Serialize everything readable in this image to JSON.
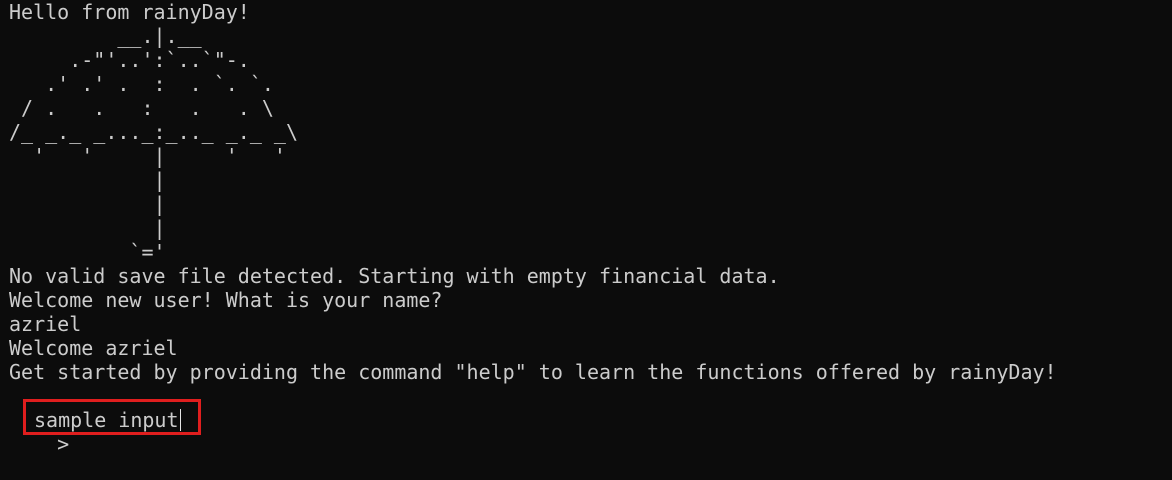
{
  "terminal": {
    "lines": [
      "Hello from rainyDay!",
      "         __.|.__",
      "     .-\"'..':`..`\"-.",
      "   .' .' .  :  . `. `.",
      " / .   .   :   .   . \\",
      "/_ _._ _..._:_.._ _._ _\\",
      "  '   '     |     '   '",
      "            |",
      "            |",
      "            |",
      "          `='",
      "No valid save file detected. Starting with empty financial data.",
      "Welcome new user! What is your name?",
      "azriel",
      "Welcome azriel",
      "Get started by providing the command \"help\" to learn the functions offered by rainyDay!"
    ],
    "prompt_symbol": ">",
    "input_value": "sample input"
  },
  "colors": {
    "background": "#0c0c0c",
    "text": "#cccccc",
    "highlight_border": "#e01e1e"
  }
}
